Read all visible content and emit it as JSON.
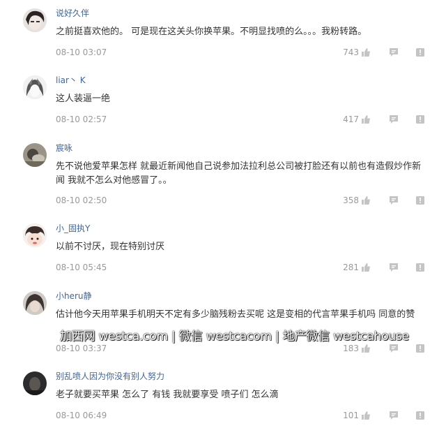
{
  "comments": [
    {
      "username": "说好久伴",
      "text": "之前挺喜欢他的。 可是现在这关头你换苹果。不明显找喷的么。。。我粉转路。",
      "time": "08-10 03:07",
      "likes": "743"
    },
    {
      "username": "liar丶 K",
      "text": "这人装逼一绝",
      "time": "08-10 02:57",
      "likes": "417"
    },
    {
      "username": "宸咏",
      "text": "先不说他爱苹果怎样 就最近新闻他自己说参加法拉利总公司被打脸还有以前也有造假炒作新闻 我就不怎么对他感冒了。。",
      "time": "08-10 02:50",
      "likes": "358"
    },
    {
      "username": "小_固执Y",
      "text": "以前不讨厌，现在特别讨厌",
      "time": "08-10 05:45",
      "likes": "281"
    },
    {
      "username": "小heru静",
      "text": "估计他今天用苹果手机明天不定有多少脑残粉去买呢 这是变相的代言苹果手机吗 同意的赞",
      "time": "08-10 03:37",
      "likes": "183"
    },
    {
      "username": "别乱喷人因为你没有别人努力",
      "text": "老子就要买苹果 怎么了 有钱 我就要享受 喷子们 怎么滴",
      "time": "08-10 06:49",
      "likes": "101"
    }
  ],
  "icons": {
    "like": "thumbs-up-icon",
    "reply": "comment-bubble-icon",
    "report": "report-flag-icon"
  },
  "colors": {
    "username": "#406599",
    "text": "#333333",
    "meta": "#999999",
    "icon": "#c4c4c4"
  },
  "watermark": "加西网 westca.com | 微信 westcacom | 地产微信 westcahouse"
}
